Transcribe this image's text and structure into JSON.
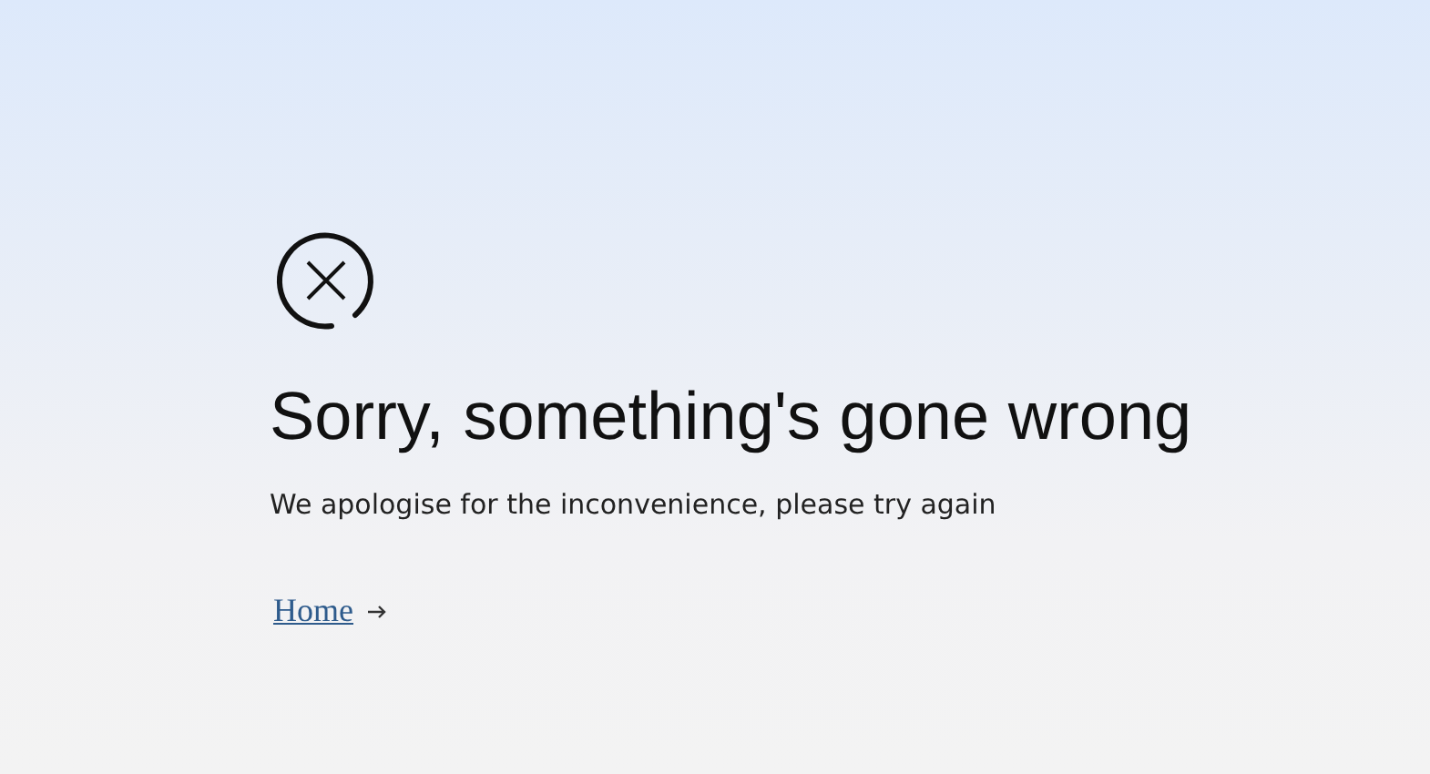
{
  "error": {
    "title": "Sorry, something's gone wrong",
    "message": "We apologise for the inconvenience, please try again"
  },
  "link": {
    "label": "Home"
  }
}
